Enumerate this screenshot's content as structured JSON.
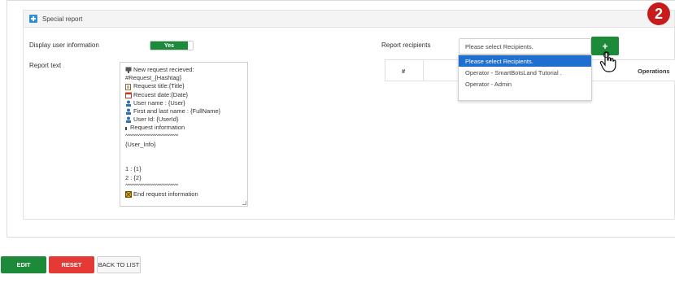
{
  "panel": {
    "title": "Special report"
  },
  "step_badge": "2",
  "display_user_info": {
    "label": "Display user information",
    "toggle_value": "Yes"
  },
  "report_text": {
    "label": "Report text",
    "lines": [
      "New request recieved:",
      "#Request_{Hashtag}",
      "Request title:{Title}",
      "Recuest date:{Date}",
      "User name : {User}",
      "First and last name : {FullName}",
      "User Id: {UserId}",
      "Request information",
      "^^^^^^^^^^^^^^^^^^^^^^^^^^^^",
      "{User_Info}",
      "",
      "",
      "1 : {1}",
      "2 : {2}",
      "^^^^^^^^^^^^^^^^^^^^^^^^^^^^",
      "End request information"
    ]
  },
  "recipients": {
    "label": "Report recipients",
    "select_value": "Please select Recipients.",
    "add_button": "+",
    "options": [
      "Please select Recipients.",
      "Operator - SmartBotsLand Tutorial .",
      "Operator - Admin"
    ],
    "table": {
      "col_number": "#",
      "col_operations": "Operations"
    }
  },
  "buttons": {
    "edit": "EDIT",
    "reset": "RESET",
    "back": "BACK TO LIST"
  },
  "colors": {
    "green": "#1d8a3a",
    "red": "#e53935",
    "badge": "#c81c1c",
    "highlight": "#1f6fd0",
    "header_icon": "#2f8fd6"
  }
}
